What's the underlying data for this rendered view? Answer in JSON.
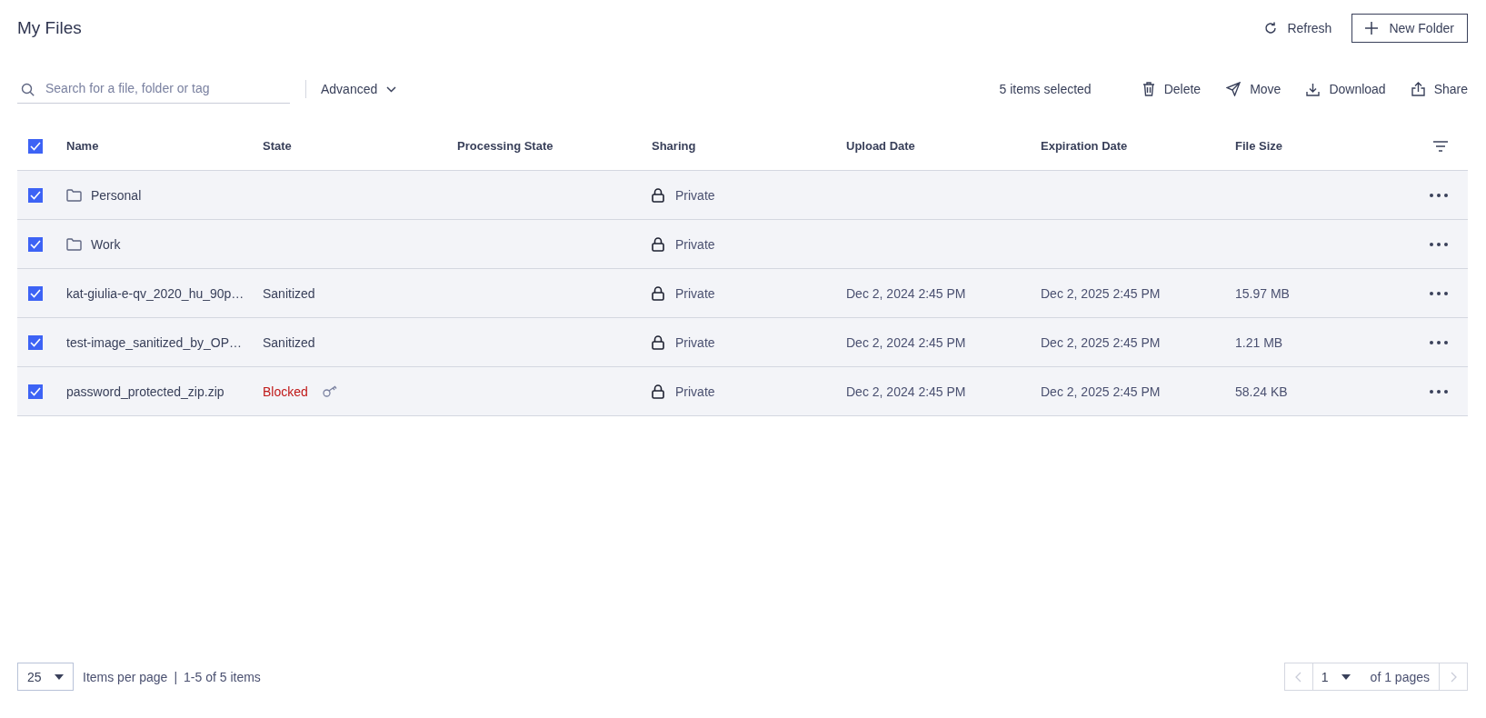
{
  "page": {
    "title": "My Files"
  },
  "header_actions": [
    {
      "kind": "refresh",
      "label": "Refresh"
    },
    {
      "kind": "new-folder",
      "label": "New Folder"
    }
  ],
  "search": {
    "placeholder": "Search for a file, folder or tag"
  },
  "advanced": {
    "label": "Advanced"
  },
  "selection": {
    "summary": "5 items selected"
  },
  "bulk_actions": [
    {
      "kind": "delete",
      "label": "Delete"
    },
    {
      "kind": "move",
      "label": "Move"
    },
    {
      "kind": "download",
      "label": "Download"
    },
    {
      "kind": "share",
      "label": "Share"
    }
  ],
  "table": {
    "select_all": {
      "checked": true
    },
    "columns": [
      "Name",
      "State",
      "Processing State",
      "Sharing",
      "Upload Date",
      "Expiration Date",
      "File Size"
    ],
    "rows": [
      {
        "kind": "folder",
        "selected": true,
        "name": "Personal",
        "sharing": "Private"
      },
      {
        "kind": "folder",
        "selected": true,
        "name": "Work",
        "sharing": "Private"
      },
      {
        "kind": "file",
        "selected": true,
        "name": "kat-giulia-e-qv_2020_hu_90p…",
        "state": {
          "kind": "sanitized",
          "label": "Sanitized"
        },
        "sharing": "Private",
        "upload_date": "Dec 2, 2024 2:45 PM",
        "expiration_date": "Dec 2, 2025 2:45 PM",
        "file_size": "15.97 MB"
      },
      {
        "kind": "file",
        "selected": true,
        "name": "test-image_sanitized_by_OP…",
        "state": {
          "kind": "sanitized",
          "label": "Sanitized"
        },
        "sharing": "Private",
        "upload_date": "Dec 2, 2024 2:45 PM",
        "expiration_date": "Dec 2, 2025 2:45 PM",
        "file_size": "1.21 MB"
      },
      {
        "kind": "file",
        "selected": true,
        "name": "password_protected_zip.zip",
        "state": {
          "kind": "blocked",
          "label": "Blocked"
        },
        "sharing": "Private",
        "upload_date": "Dec 2, 2024 2:45 PM",
        "expiration_date": "Dec 2, 2025 2:45 PM",
        "file_size": "58.24 KB"
      }
    ]
  },
  "pagination": {
    "page_size": "25",
    "page_size_label": "Items per page",
    "separator": "|",
    "range": "1-5 of 5 items",
    "page": "1",
    "page_count": "of 1 pages",
    "prev_disabled": true,
    "next_disabled": true
  }
}
